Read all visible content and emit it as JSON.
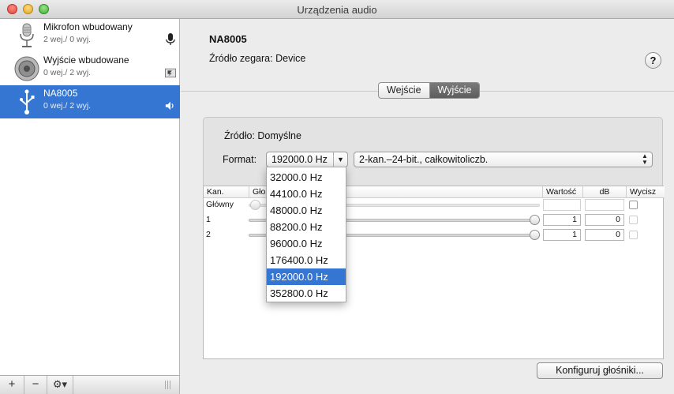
{
  "window": {
    "title": "Urządzenia audio"
  },
  "sidebar": {
    "devices": [
      {
        "name": "Mikrofon wbudowany",
        "io": "2 wej./ 0 wyj.",
        "icon": "microphone-icon",
        "kind": "microphone-small-icon",
        "selected": false
      },
      {
        "name": "Wyjście wbudowane",
        "io": "0 wej./ 2 wyj.",
        "icon": "speaker-icon",
        "kind": "system-alert-icon",
        "selected": false
      },
      {
        "name": "NA8005",
        "io": "0 wej./ 2 wyj.",
        "icon": "usb-icon",
        "kind": "volume-icon",
        "selected": true
      }
    ],
    "add_label": "+",
    "remove_label": "−",
    "gear_label": "⚙▾"
  },
  "detail": {
    "device_title": "NA8005",
    "clock_label": "Źródło zegara:",
    "clock_value": "Device",
    "help_label": "?",
    "tabs": [
      {
        "label": "Wejście",
        "active": false
      },
      {
        "label": "Wyjście",
        "active": true
      }
    ],
    "source_label": "Źródło:",
    "source_value": "Domyślne",
    "format_label": "Format:",
    "rate_value": "192000.0 Hz",
    "format_value": "2-kan.–24-bit., całkowitoliczb.",
    "table": {
      "col_channel": "Kan.",
      "col_volume": "Głośność",
      "col_value": "Wartość",
      "col_db": "dB",
      "col_mute": "Wycisz",
      "rows": [
        {
          "label": "Główny",
          "value": "",
          "db": "",
          "slider": 0.0
        },
        {
          "label": "1",
          "value": "1",
          "db": "0",
          "slider": 1.0
        },
        {
          "label": "2",
          "value": "1",
          "db": "0",
          "slider": 1.0
        }
      ]
    },
    "configure_button": "Konfiguruj głośniki..."
  },
  "rate_menu": {
    "options": [
      "32000.0 Hz",
      "44100.0 Hz",
      "48000.0 Hz",
      "88200.0 Hz",
      "96000.0 Hz",
      "176400.0 Hz",
      "192000.0 Hz",
      "352800.0 Hz"
    ],
    "selected": "192000.0 Hz"
  },
  "colors": {
    "selection": "#3476d2"
  }
}
